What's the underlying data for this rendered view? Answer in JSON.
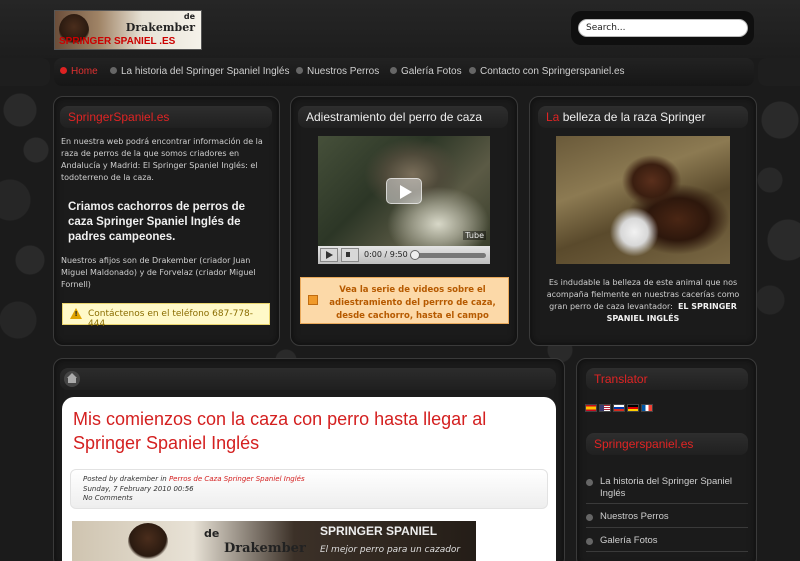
{
  "header": {
    "logo": {
      "de": "de",
      "brand": "Drakember",
      "name": "SPRINGER SPANIEL .ES"
    },
    "search": {
      "value": "Search..."
    }
  },
  "nav": {
    "items": [
      {
        "label": "Home",
        "active": true
      },
      {
        "label": "La historia del Springer Spaniel Inglés"
      },
      {
        "label": "Nuestros Perros"
      },
      {
        "label": "Galería Fotos"
      },
      {
        "label": "Contacto con Springerspaniel.es"
      }
    ]
  },
  "box1": {
    "title": "SpringerSpaniel.es",
    "intro": "En nuestra web podrá encontrar información de la raza de perros de la que somos criadores en Andalucía y Madrid: El Springer Spaniel Inglés: el todoterreno de la caza.",
    "highlight": "Criamos cachorros de perros de caza Springer Spaniel Inglés de padres campeones.",
    "origin": "Nuestros afijos son de Drakember (criador Juan Miguel Maldonado) y de Forvelaz (criador Miguel Fornell)",
    "contact": "Contáctenos en el teléfono 687-778-444"
  },
  "box2": {
    "title": "Adiestramiento del perro de caza",
    "video": {
      "time": "0:00 / 9:50",
      "logo": "Tube"
    },
    "note": "Vea la serie de videos sobre el adiestramiento del perrro de caza, desde cachorro, hasta el campo"
  },
  "box3": {
    "title_accent": "La",
    "title_rest": " belleza de la raza Springer",
    "caption": "Es indudable la belleza de este animal que nos acompaña fielmente en nuestras cacerías como gran perro de caza levantador:",
    "caption_bold": "EL SPRINGER SPANIEL INGLÉS"
  },
  "article": {
    "title": "Mis comienzos con la caza con perro hasta llegar al Springer Spaniel Inglés",
    "posted_by": "Posted by drakember in ",
    "category": "Perros de Caza Springer Spaniel Inglés",
    "date": "Sunday, 7 February 2010 00:56",
    "comments": "No Comments",
    "banner": {
      "de": "de",
      "brand": "Drakember",
      "name": "SPRINGER SPANIEL",
      "tagline": "El mejor perro para un cazador"
    }
  },
  "sidebar": {
    "translator_title": "Translator",
    "flags": [
      "#c60b1e",
      "#3c3b6e",
      "#0039a6",
      "#000000",
      "#0055a4"
    ],
    "section_title": "Springerspaniel.es",
    "items": [
      {
        "label": "La historia del Springer Spaniel Inglés"
      },
      {
        "label": "Nuestros Perros"
      },
      {
        "label": "Galería Fotos"
      }
    ]
  }
}
